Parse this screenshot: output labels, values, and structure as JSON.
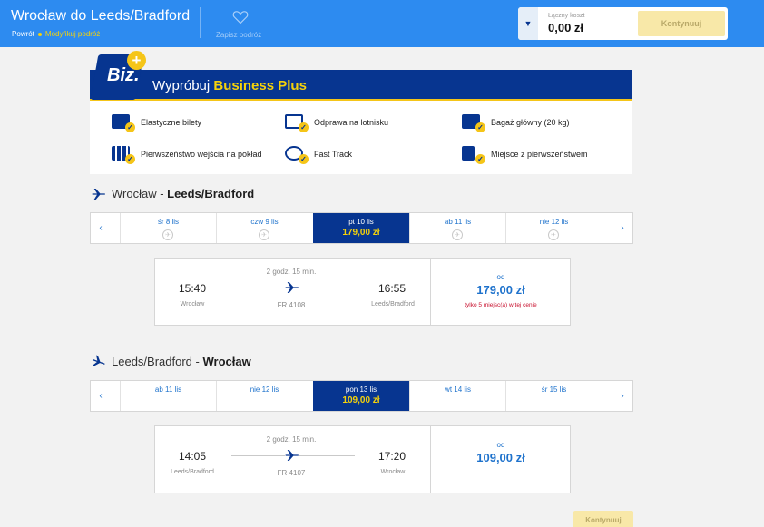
{
  "header": {
    "title": "Wrocław do Leeds/Bradford",
    "trip_type": "Powrót",
    "modify_link": "Modyfikuj podróż",
    "save_trip": "Zapisz podróż",
    "total_label": "Łączny koszt",
    "total_value": "0,00 zł",
    "continue_label": "Kontynuuj"
  },
  "business_plus": {
    "logo_text": "Biz.",
    "title_prefix": "Wypróbuj ",
    "title_highlight": "Business Plus",
    "features": [
      {
        "label": "Elastyczne bilety",
        "icon": "ticket-icon"
      },
      {
        "label": "Odprawa na lotnisku",
        "icon": "airport-checkin-icon"
      },
      {
        "label": "Bagaż główny (20 kg)",
        "icon": "suitcase-icon"
      },
      {
        "label": "Pierwszeństwo wejścia na pokład",
        "icon": "priority-boarding-icon"
      },
      {
        "label": "Fast Track",
        "icon": "fast-track-icon"
      },
      {
        "label": "Miejsce z pierwszeństwem",
        "icon": "seat-icon"
      }
    ]
  },
  "outbound": {
    "from": "Wrocław",
    "separator": " - ",
    "to": "Leeds/Bradford",
    "dates": [
      {
        "label": "śr 8 lis",
        "price": null,
        "selected": false
      },
      {
        "label": "czw 9 lis",
        "price": null,
        "selected": false
      },
      {
        "label": "pt 10 lis",
        "price": "179,00 zł",
        "selected": true
      },
      {
        "label": "ab 11 lis",
        "price": null,
        "selected": false
      },
      {
        "label": "nie 12 lis",
        "price": null,
        "selected": false
      }
    ],
    "flight": {
      "duration": "2 godz. 15 min.",
      "dep_time": "15:40",
      "dep_city": "Wrocław",
      "flight_no": "FR 4108",
      "arr_time": "16:55",
      "arr_city": "Leeds/Bradford",
      "from_label": "od",
      "price": "179,00 zł",
      "availability": "tylko 5 miejsc(a) w tej cenie"
    }
  },
  "inbound": {
    "from": "Leeds/Bradford",
    "separator": " - ",
    "to": "Wrocław",
    "dates": [
      {
        "label": "ab 11 lis",
        "price": null,
        "selected": false
      },
      {
        "label": "nie 12 lis",
        "price": null,
        "selected": false
      },
      {
        "label": "pon 13 lis",
        "price": "109,00 zł",
        "selected": true
      },
      {
        "label": "wt 14 lis",
        "price": null,
        "selected": false
      },
      {
        "label": "śr 15 lis",
        "price": null,
        "selected": false
      }
    ],
    "flight": {
      "duration": "2 godz. 15 min.",
      "dep_time": "14:05",
      "dep_city": "Leeds/Bradford",
      "flight_no": "FR 4107",
      "arr_time": "17:20",
      "arr_city": "Wrocław",
      "from_label": "od",
      "price": "109,00 zł"
    }
  },
  "footer": {
    "continue_label": "Kontynuuj"
  },
  "colors": {
    "header_blue": "#2d8bf0",
    "navy": "#073590",
    "yellow": "#f5c518",
    "link_blue": "#1e72cc",
    "warning_red": "#c8102e"
  }
}
